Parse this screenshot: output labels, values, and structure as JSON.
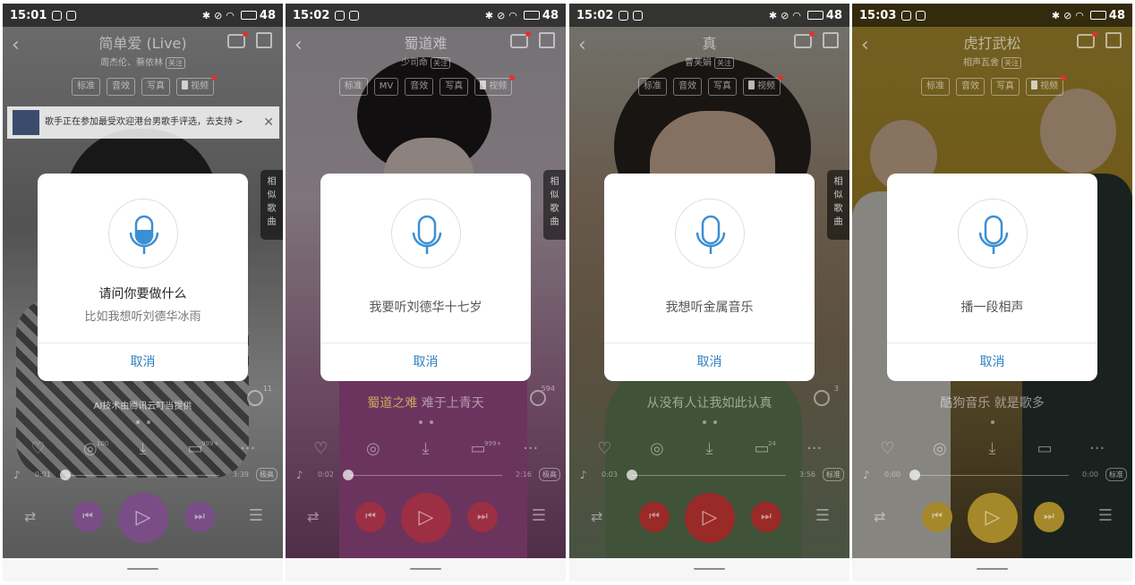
{
  "accent_color": "#2b7fc2",
  "mic_color": "#3b8fd4",
  "screens": [
    {
      "status_time": "15:01",
      "status_level": "48",
      "song_title": "简单爱 (Live)",
      "artist": "周杰伦、蔡依林",
      "follow": "关注",
      "quality_buttons": [
        "标准",
        "音效",
        "写真"
      ],
      "video_label": "视频",
      "notice_text": "歌手正在参加最受欢迎港台男歌手评选，去支持 >",
      "notice_close": "✕",
      "similar_tab": [
        "相",
        "似",
        "歌",
        "曲"
      ],
      "lyric_text": "AI技术由腾讯云叮当提供",
      "mic_count": "11",
      "action_counts": [
        "",
        "100",
        "",
        "999+",
        ""
      ],
      "time_current": "0:01",
      "time_total": "3:39",
      "quality_badge": "极高",
      "prompt": "请问你要做什么",
      "hint": "比如我想听刘德华冰雨",
      "phrase": "",
      "cancel": "取消"
    },
    {
      "status_time": "15:02",
      "status_level": "48",
      "song_title": "蜀道难",
      "artist": "少司命",
      "follow": "关注",
      "quality_buttons": [
        "标准",
        "MV",
        "音效",
        "写真"
      ],
      "video_label": "视频",
      "notice_text": "",
      "notice_close": "",
      "similar_tab": [
        "相",
        "似",
        "歌",
        "曲"
      ],
      "lyric_hl": "蜀道之难",
      "lyric_text": " 难于上青天",
      "mic_count": "594",
      "action_counts": [
        "",
        "",
        "",
        "999+",
        ""
      ],
      "time_current": "0:02",
      "time_total": "2:16",
      "quality_badge": "极高",
      "prompt": "",
      "hint": "",
      "phrase": "我要听刘德华十七岁",
      "cancel": "取消"
    },
    {
      "status_time": "15:02",
      "status_level": "48",
      "song_title": "真",
      "artist": "曹芙娟",
      "follow": "关注",
      "quality_buttons": [
        "标准",
        "音效",
        "写真"
      ],
      "video_label": "视频",
      "notice_text": "",
      "notice_close": "",
      "similar_tab": [
        "相",
        "似",
        "歌",
        "曲"
      ],
      "lyric_text": "从没有人让我如此认真",
      "mic_count": "3",
      "action_counts": [
        "",
        "",
        "",
        "24",
        ""
      ],
      "time_current": "0:03",
      "time_total": "3:56",
      "quality_badge": "标准",
      "prompt": "",
      "hint": "",
      "phrase": "我想听金属音乐",
      "cancel": "取消"
    },
    {
      "status_time": "15:03",
      "status_level": "48",
      "song_title": "虎打武松",
      "artist": "相声瓦舍",
      "follow": "关注",
      "quality_buttons": [
        "标准",
        "音效",
        "写真"
      ],
      "video_label": "视频",
      "notice_text": "",
      "notice_close": "",
      "similar_tab": [],
      "lyric_text": "酷狗音乐 就是歌多",
      "mic_count": "",
      "action_counts": [
        "",
        "",
        "",
        "",
        ""
      ],
      "time_current": "0:00",
      "time_total": "0:00",
      "quality_badge": "标准",
      "prompt": "",
      "hint": "",
      "phrase": "播一段相声",
      "cancel": "取消"
    }
  ]
}
